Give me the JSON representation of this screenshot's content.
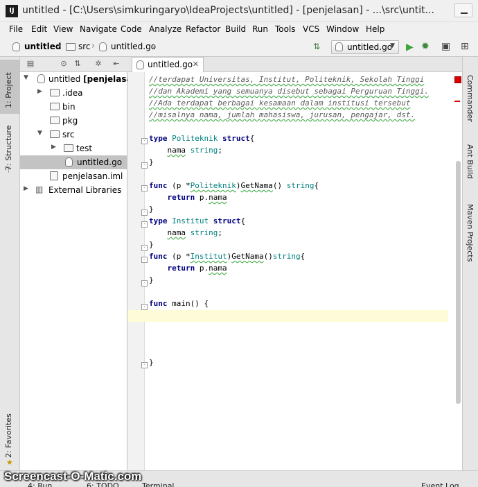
{
  "window": {
    "app_icon": "intellij-icon",
    "app_icon_text": "IJ",
    "title": "untitled - [C:\\Users\\simkuringaryo\\IdeaProjects\\untitled] - [penjelasan] - ...\\src\\untit..."
  },
  "menu": [
    "File",
    "Edit",
    "View",
    "Navigate",
    "Code",
    "Analyze",
    "Refactor",
    "Build",
    "Run",
    "Tools",
    "VCS",
    "Window",
    "Help"
  ],
  "breadcrumb": {
    "project": "untitled",
    "folder": "src",
    "file": "untitled.go"
  },
  "toolbar": {
    "run_config": "untitled.go"
  },
  "left_tool_tabs": {
    "project": "1: Project",
    "structure": "7: Structure",
    "favorites": "2: Favorites"
  },
  "right_tool_tabs": [
    "Commander",
    "Ant Build",
    "Maven Projects"
  ],
  "project_tree": [
    {
      "label": "untitled",
      "suffix": "[penjelasan]",
      "icon": "module-icon"
    },
    {
      "label": ".idea",
      "icon": "folder-icon"
    },
    {
      "label": "bin",
      "icon": "folder-icon"
    },
    {
      "label": "pkg",
      "icon": "folder-icon"
    },
    {
      "label": "src",
      "icon": "folder-icon"
    },
    {
      "label": "test",
      "icon": "package-folder-icon"
    },
    {
      "label": "untitled.go",
      "icon": "go-file-icon"
    },
    {
      "label": "penjelasan.iml",
      "icon": "iml-file-icon"
    },
    {
      "label": "External Libraries",
      "icon": "library-icon"
    }
  ],
  "editor": {
    "tab": "untitled.go",
    "lines": {
      "c1": "//terdapat Universitas, Institut, Politeknik, Sekolah Tinggi",
      "c2": "//dan Akademi yang semuanya disebut sebagai Perguruan Tinggi.",
      "c3": "//Ada terdapat berbagai kesamaan dalam institusi tersebut",
      "c4": "//misalnya nama, jumlah mahasiswa, jurusan, pengajar, dst.",
      "kw_type": "type",
      "kw_struct": "struct",
      "kw_func": "func",
      "kw_return": "return",
      "type_string": "string",
      "t1_name": "Politeknik",
      "t2_name": "Institut",
      "field": "nama",
      "method": "GetNama",
      "recv": "p",
      "p_dot": "p.",
      "main": "main",
      "open_brace": "{",
      "close_brace": "}"
    }
  },
  "bottom": {
    "run": "4: Run",
    "todo": "6: TODO",
    "terminal": "Terminal",
    "event_log": "Event Log"
  },
  "watermark": "Screencast-O-Matic.com",
  "colors": {
    "keyword": "#000080",
    "type": "#008080",
    "comment": "#5a5a5a",
    "caret_line": "#fdfbd8",
    "run_green": "#3aa63a",
    "error_red": "#d80000"
  }
}
